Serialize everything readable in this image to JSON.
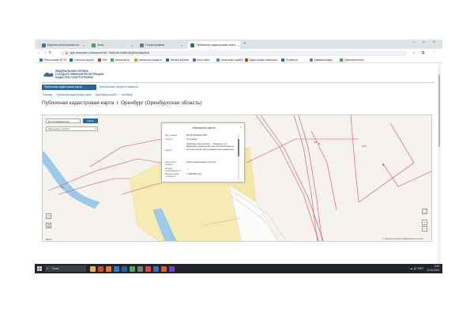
{
  "browser": {
    "tabs": [
      {
        "label": "Единая электронная мо...",
        "color": "#3b6fc4",
        "active": false
      },
      {
        "label": "Чаты",
        "color": "#3aa757",
        "active": false
      },
      {
        "label": "Госпрограммы",
        "color": "#7a7a7a",
        "active": false
      },
      {
        "label": "Публичная кадастровая карта",
        "color": "#1f6aa5",
        "active": true
      }
    ],
    "new_tab": "+",
    "window_controls": [
      "–",
      "□",
      "×"
    ],
    "url": "pkk.rosreestr.ru/#/search/51.7666,55.0998/16/@5w3tqw5cb",
    "bookmarks": [
      {
        "label": "Регистрация ЮГЭЛ",
        "color": "#3b6fc4"
      },
      {
        "label": "Госуслуги портал",
        "color": "#1f6aa5"
      },
      {
        "label": "ФНС",
        "color": "#c8392b"
      },
      {
        "label": "Калькулятор",
        "color": "#3aa757"
      },
      {
        "label": "Ипотечные кредиты",
        "color": "#e0a100"
      },
      {
        "label": "Личный кабинет",
        "color": "#1f6aa5"
      },
      {
        "label": "Мои сайты",
        "color": "#3b6fc4"
      },
      {
        "label": "Налоговая служба",
        "color": "#3aa757"
      },
      {
        "label": "Кадастровые инженеры",
        "color": "#c8392b"
      },
      {
        "label": "Росреестр",
        "color": "#1f6aa5"
      },
      {
        "label": "Администрация",
        "color": "#7a7a7a"
      },
      {
        "label": "Публичная карта",
        "color": "#3aa757"
      }
    ]
  },
  "site": {
    "logo_text": "ФЕДЕРАЛЬНАЯ СЛУЖБА ГОСУДАРСТВЕННОЙ РЕГИСТРАЦИИ, КАДАСТРА И КАРТОГРАФИИ",
    "service_button": "Публичная кадастровая карта",
    "service_link": "Электронные услуги и сервисы",
    "breadcrumb": [
      "Главная",
      "Публичная кадастровая карта",
      "Оренбургская обл.",
      "Оренбург"
    ],
    "page_title": "Публичная кадастровая карта: г. Оренбург (Оренбургская область)"
  },
  "map": {
    "search_value": "56:44:0000000:1087",
    "search_button": "Найти",
    "layer_select": "Земельные участки",
    "popup": {
      "title": "Земельный участок",
      "close": "×",
      "rows": [
        {
          "label": "Кад. номер:",
          "value": "56:44:0000000:1087"
        },
        {
          "label": "Статус:",
          "value": "Учтенный"
        },
        {
          "label": "Адрес:",
          "value": "Оренбургская область, г. Оренбург, ул. Шевченко, земельный участок расположен в юго-восточной части кадастрового квартала"
        },
        {
          "label": "Категория земель:",
          "value": "Земли населенных пунктов"
        },
        {
          "label": "Форма собственности:",
          "value": "—"
        },
        {
          "label": "Кадастровая стоимость:",
          "value": "1 205 000 руб."
        }
      ],
      "footer": "Подробнее"
    },
    "parcel_labels": [
      "375",
      "105",
      "1070"
    ],
    "controls": {
      "layers": "⊂",
      "print": "⎙",
      "fullscreen": "⛶",
      "zoom_in": "+",
      "zoom_out": "−"
    },
    "scale": "200 м",
    "copyright": "© Росреестр   Картографическая основа"
  },
  "taskbar": {
    "search_placeholder": "Поиск",
    "time": "9:26",
    "date": "11.03.2023",
    "apps": [
      "#e5b64a",
      "#d9412f",
      "#f07a21",
      "#2a7bd4",
      "#1d5fa8",
      "#4caf50",
      "#7a7a7a",
      "#e04a3a",
      "#3b6fc4",
      "#d85f2a",
      "#6f42c1"
    ]
  }
}
